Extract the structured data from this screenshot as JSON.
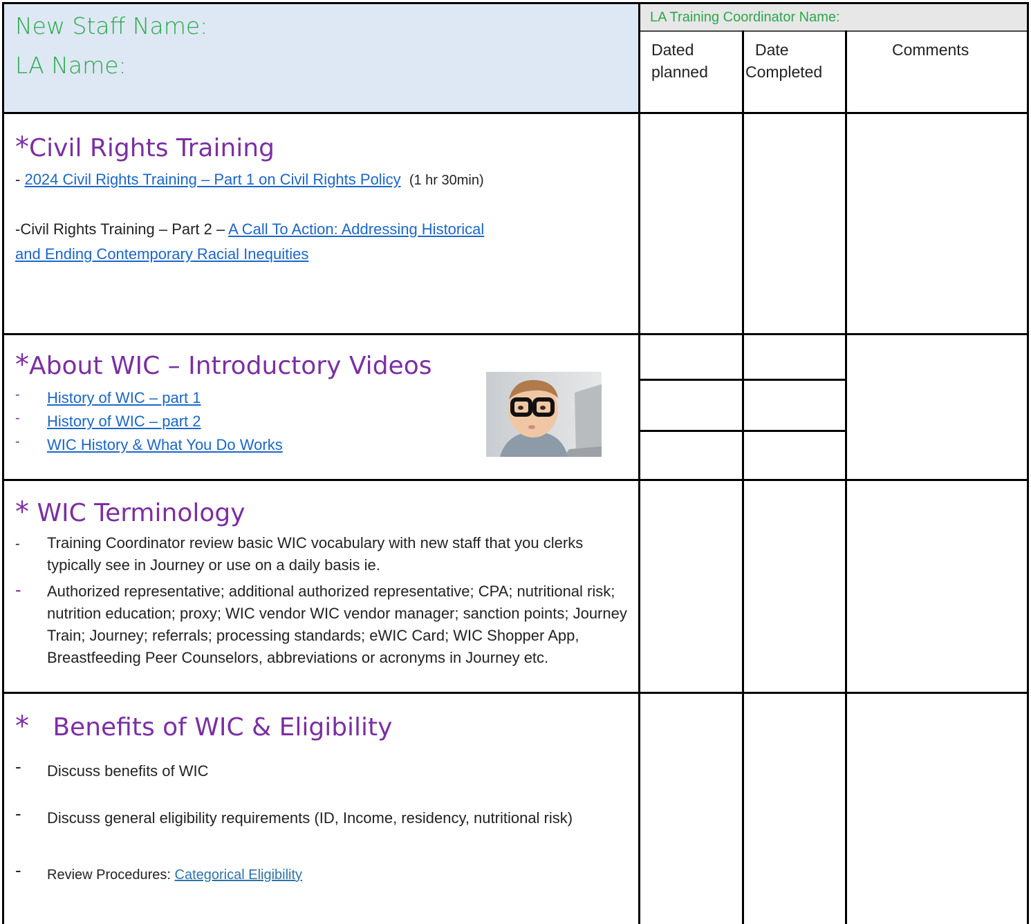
{
  "header": {
    "new_staff_label": "New Staff Name:",
    "la_name_label": "LA Name:",
    "coordinator_label": "LA Training Coordinator Name:",
    "col_planned_1": "Dated",
    "col_planned_2": "planned",
    "col_completed_1": "Date",
    "col_completed_2": "Completed",
    "col_comments": "Comments"
  },
  "civil_rights": {
    "star": "*",
    "title": "Civil Rights Training",
    "item1_prefix": "- ",
    "item1_link": "2024 Civil Rights Training – Part 1 on Civil Rights Policy",
    "item1_suffix": "(1 hr 30min)",
    "item2_prefix": "-Civil Rights Training  –   Part 2 – ",
    "item2_link_1": "A Call To Action: Addressing Historical",
    "item2_link_2": "and Ending Contemporary Racial Inequities"
  },
  "about_wic": {
    "star": "*",
    "title": "About WIC – Introductory Videos",
    "links": [
      "History of WIC – part 1",
      "History of WIC – part 2",
      "WIC History & What You Do Works"
    ]
  },
  "terminology": {
    "star": "*",
    "title": "WIC Terminology",
    "item1": "Training Coordinator review basic WIC vocabulary with new staff that you clerks typically see in Journey or use on a daily basis ie.",
    "item2": "Authorized representative; additional authorized representative; CPA; nutritional risk; nutrition education; proxy; WIC vendor WIC vendor manager; sanction points; Journey Train; Journey; referrals; processing standards; eWIC Card; WIC Shopper App, Breastfeeding Peer Counselors, abbreviations or acronyms in Journey etc."
  },
  "benefits": {
    "star": "*",
    "title": "Benefits of WIC & Eligibility",
    "item1": "Discuss benefits of WIC",
    "item2": "Discuss general eligibility requirements (ID, Income, residency, nutritional risk)",
    "item3_prefix": "Review Procedures:  ",
    "item3_link": "Categorical Eligibility"
  },
  "colors": {
    "header_bg": "#dde8f4",
    "green": "#2aa84a",
    "purple": "#7b2fa3",
    "link": "#1a66c9"
  }
}
